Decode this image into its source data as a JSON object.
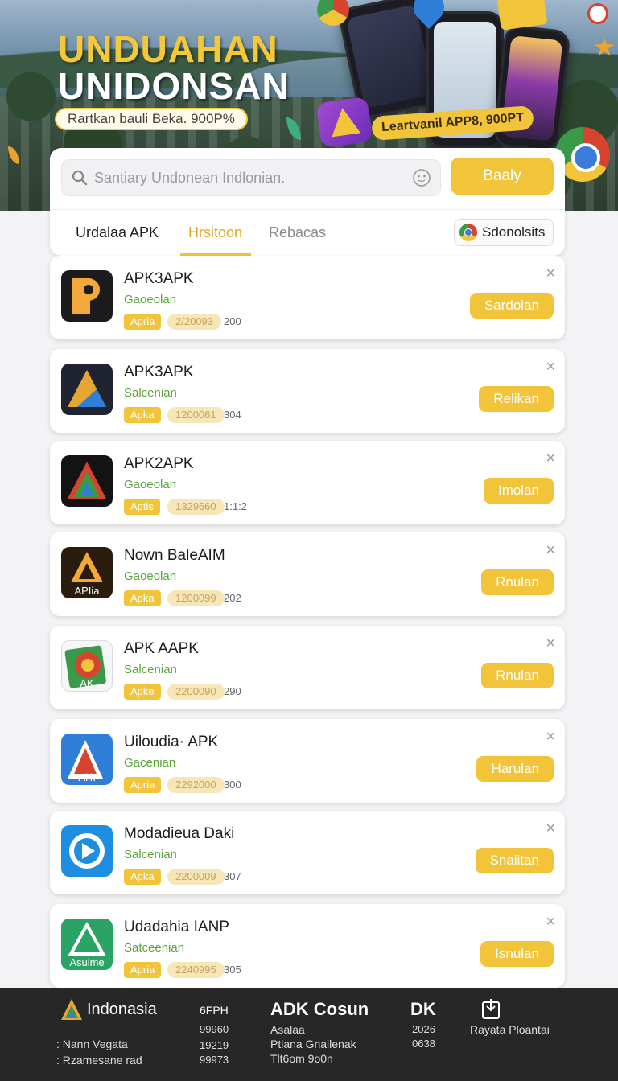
{
  "banner": {
    "title_line1": "UNDUAHAN",
    "title_line2": "UNIDONSAN",
    "pill_text": "Rartkan bauli Beka. 900P%",
    "promo_text": "Leartvanil APP8, 900PT"
  },
  "search": {
    "placeholder": "Santiary Undonean Indlonian.",
    "button_label": "Baaly"
  },
  "tabs": [
    {
      "label": "Urdalaa APK"
    },
    {
      "label": "Hrsitoon"
    },
    {
      "label": "Rebacas"
    }
  ],
  "region_chip": {
    "label": "Sdonolsits"
  },
  "apps": [
    {
      "name": "APK3APK",
      "category": "Gaoeolan",
      "tag": "Apria",
      "number": "2/20093",
      "size": "200",
      "button": "Sardoian"
    },
    {
      "name": "APK3APK",
      "category": "Salcenian",
      "tag": "Apka",
      "number": "1200061",
      "size": "304",
      "button": "Relikan"
    },
    {
      "name": "APK2APK",
      "category": "Gaoeolan",
      "tag": "Aptis",
      "number": "1329660",
      "size": "1:1:2",
      "button": "Imolan"
    },
    {
      "name": "Nown BaleAIM",
      "category": "Gaoeolan",
      "tag": "Apka",
      "number": "1200099",
      "size": "202",
      "button": "Rnulan"
    },
    {
      "name": "APK AAPK",
      "category": "Salcenian",
      "tag": "Apke",
      "number": "2200090",
      "size": "290",
      "button": "Rnulan"
    },
    {
      "name": "Uiloudia· APK",
      "category": "Gacenian",
      "tag": "Apria",
      "number": "2292000",
      "size": "300",
      "button": "Harulan"
    },
    {
      "name": "Modadieua Daki",
      "category": "Salcenian",
      "tag": "Apka",
      "number": "2200009",
      "size": "307",
      "button": "Snaiitan"
    },
    {
      "name": "Udadahia IANP",
      "category": "Satceenian",
      "tag": "Apria",
      "number": "2240995",
      "size": "305",
      "button": "Isnulan"
    }
  ],
  "icon_texts": [
    "",
    "",
    "",
    "APIia",
    "AK",
    "Alik",
    "",
    "Asuime"
  ],
  "footer": {
    "brand": "Indonasia",
    "bullets": [
      "Nann Vegata",
      "Rzamesane rad"
    ],
    "col1": [
      "6FPH",
      "99960",
      "19219",
      "99973"
    ],
    "adk_head": "ADK Cosun",
    "col2": [
      "Asalaa",
      "Ptiana Gnallenak",
      "Tlt6om 9o0n"
    ],
    "dk_head": "DK",
    "col3": [
      "2026",
      "0638"
    ],
    "right_label": "Rayata Ploantai"
  },
  "colors": {
    "accent": "#f1c43a",
    "category_green": "#5aa53a",
    "footer_bg": "#272727"
  }
}
